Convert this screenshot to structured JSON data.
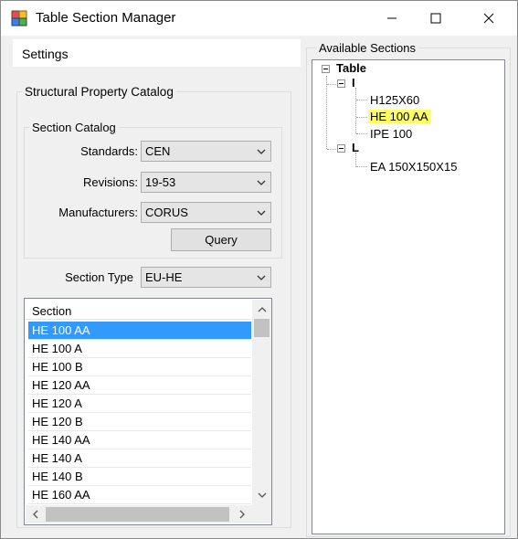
{
  "window": {
    "title": "Table Section Manager"
  },
  "settings_tab": {
    "label": "Settings"
  },
  "catalog_group": {
    "title": "Structural Property Catalog",
    "section_catalog": {
      "title": "Section Catalog",
      "standards_label": "Standards:",
      "standards_value": "CEN",
      "revisions_label": "Revisions:",
      "revisions_value": "19-53",
      "manufacturers_label": "Manufacturers:",
      "manufacturers_value": "CORUS",
      "query_label": "Query"
    },
    "section_type_label": "Section Type",
    "section_type_value": "EU-HE"
  },
  "section_list": {
    "header": "Section",
    "rows": [
      "HE 100 AA",
      "HE 100 A",
      "HE 100 B",
      "HE 120 AA",
      "HE 120 A",
      "HE 120 B",
      "HE 140 AA",
      "HE 140 A",
      "HE 140 B",
      "HE 160 AA"
    ],
    "selected_index": 0
  },
  "available_sections": {
    "title": "Available Sections",
    "root": "Table",
    "groups": [
      {
        "label": "I",
        "items": [
          "H125X60",
          "HE 100 AA",
          "IPE 100"
        ]
      },
      {
        "label": "L",
        "items": [
          "EA 150X150X15"
        ]
      }
    ],
    "highlighted": "HE 100 AA"
  },
  "colors": {
    "selection": "#3399ff",
    "highlight": "#ffff66"
  }
}
